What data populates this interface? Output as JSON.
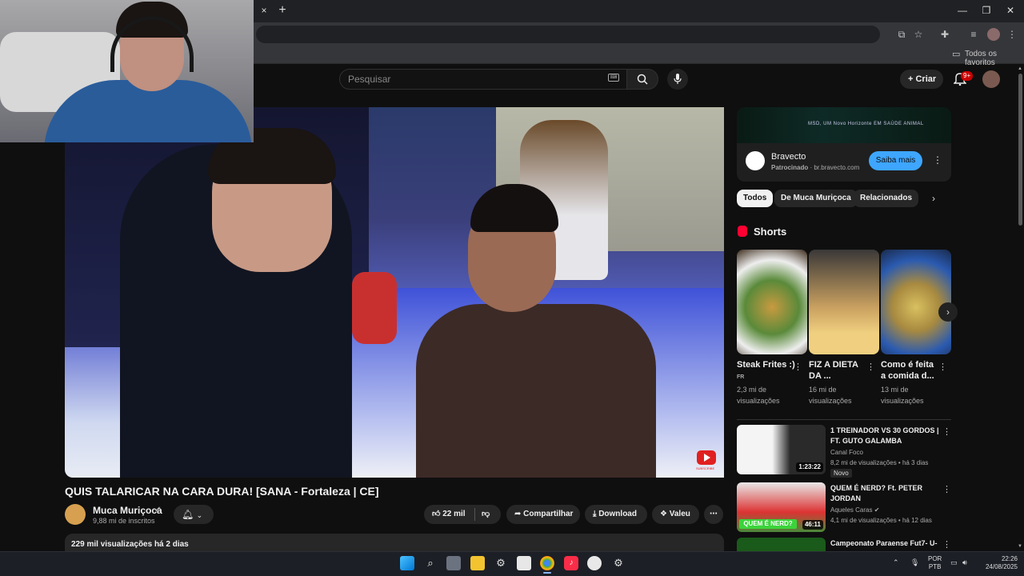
{
  "browser": {
    "tab_close": "×",
    "new_tab": "+",
    "window_controls": {
      "minimize": "—",
      "maximize": "❐",
      "close": "✕"
    },
    "bookmarks_label": "Todos os favoritos"
  },
  "header": {
    "search_placeholder": "Pesquisar",
    "create_label": "Criar",
    "notifications_badge": "9+"
  },
  "video": {
    "title": "QUIS TALARICAR NA CARA DURA! [SANA - Fortaleza | CE]",
    "channel_name": "Muca Muriçoca",
    "subscribers": "9,88 mi de inscritos",
    "likes": "22 mil",
    "share_label": "Compartilhar",
    "download_label": "Download",
    "thanks_label": "Valeu",
    "description_meta": "229 mil visualizações  há 2 dias",
    "watermark_text": "SUBSCRIBE"
  },
  "ad": {
    "banner_text": "MSD, UM Novo Horizonte EM SAÚDE ANIMAL",
    "title": "Bravecto",
    "sponsored_label": "Patrocinado",
    "domain": "br.bravecto.com",
    "cta": "Saiba mais"
  },
  "chips": [
    "Todos",
    "De Muca Muriçoca",
    "Relacionados"
  ],
  "shorts": {
    "title": "Shorts",
    "items": [
      {
        "title": "Steak Frites :)",
        "tag": "FR",
        "views": "2,3 mi de visualizações"
      },
      {
        "title": "FIZ A DIETA DA ...",
        "views": "16 mi de visualizações"
      },
      {
        "title": "Como é feita a comida d...",
        "views": "13 mi de visualizações"
      }
    ]
  },
  "related": [
    {
      "title": "1 TREINADOR VS 30 GORDOS | FT. GUTO GALAMBA",
      "channel": "Canal Foco",
      "meta": "8,2 mi de visualizações • há 3 dias",
      "duration": "1:23:22",
      "badge": "Novo"
    },
    {
      "title": "QUEM É NERD? Ft. PETER JORDAN",
      "channel": "Aqueles Caras",
      "meta": "4,1 mi de visualizações • há 12 dias",
      "duration": "46:11",
      "thumb_text": "QUEM É NERD?"
    },
    {
      "title": "Campeonato Paraense Fut7- U-"
    }
  ],
  "taskbar": {
    "lang_line1": "POR",
    "lang_line2": "PTB",
    "time": "22:26",
    "date": "24/08/2025"
  }
}
